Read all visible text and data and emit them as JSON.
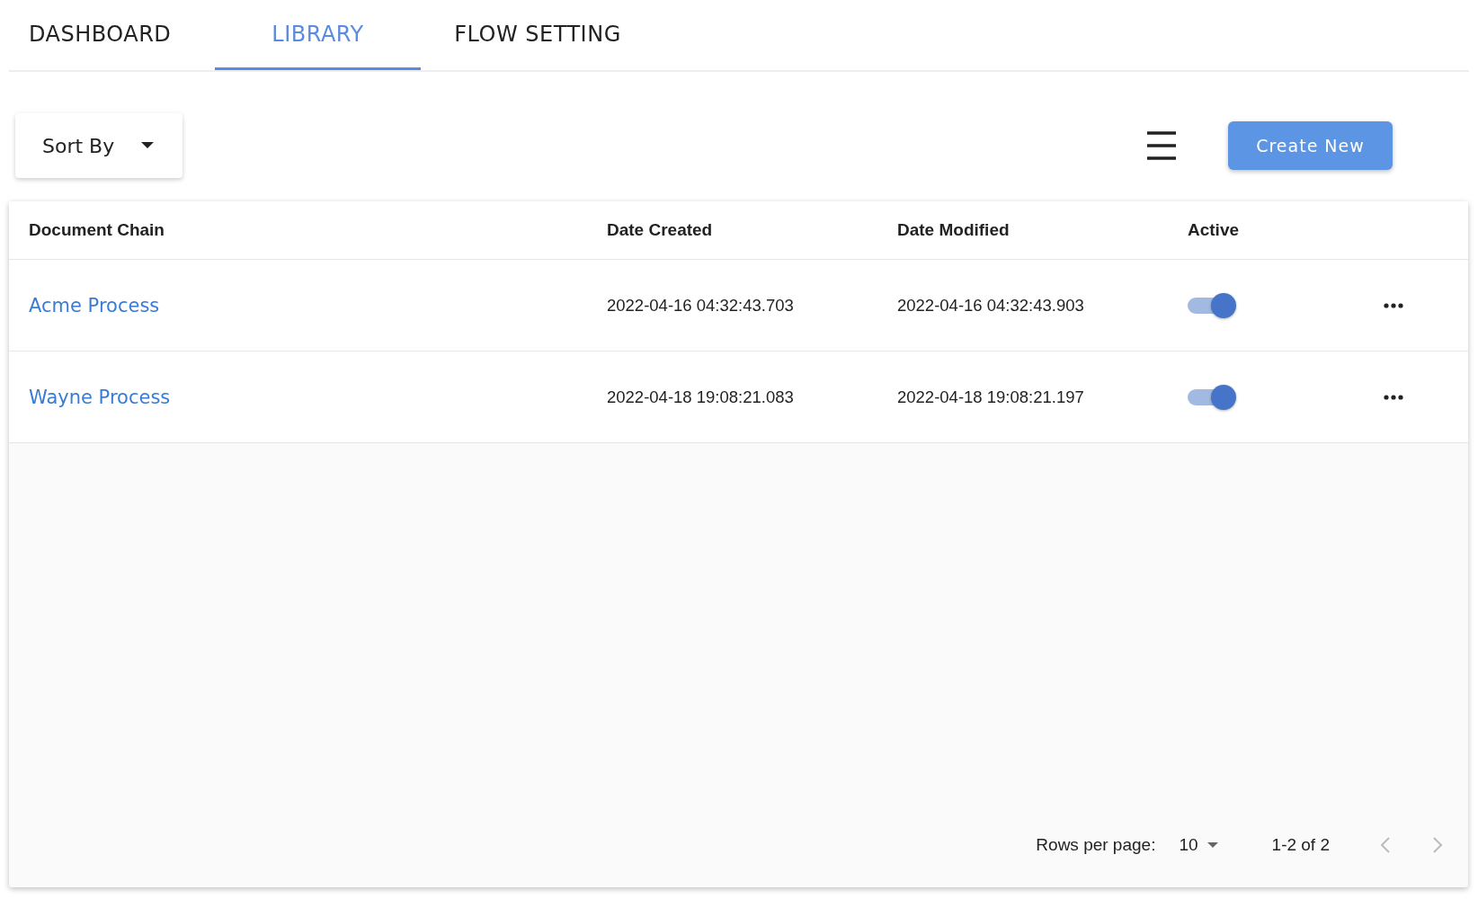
{
  "tabs": [
    {
      "label": "DASHBOARD",
      "selected": false
    },
    {
      "label": "LIBRARY",
      "selected": true
    },
    {
      "label": "FLOW SETTING",
      "selected": false
    }
  ],
  "toolbar": {
    "sort_label": "Sort By",
    "create_button": "Create New"
  },
  "table": {
    "columns": [
      "Document Chain",
      "Date Created",
      "Date Modified",
      "Active"
    ],
    "rows": [
      {
        "name": "Acme Process",
        "created": "2022-04-16 04:32:43.703",
        "modified": "2022-04-16 04:32:43.903",
        "active": true
      },
      {
        "name": "Wayne Process",
        "created": "2022-04-18 19:08:21.083",
        "modified": "2022-04-18 19:08:21.197",
        "active": true
      }
    ]
  },
  "pagination": {
    "rows_per_page_label": "Rows per page:",
    "rows_per_page": "10",
    "range": "1-2 of 2"
  }
}
